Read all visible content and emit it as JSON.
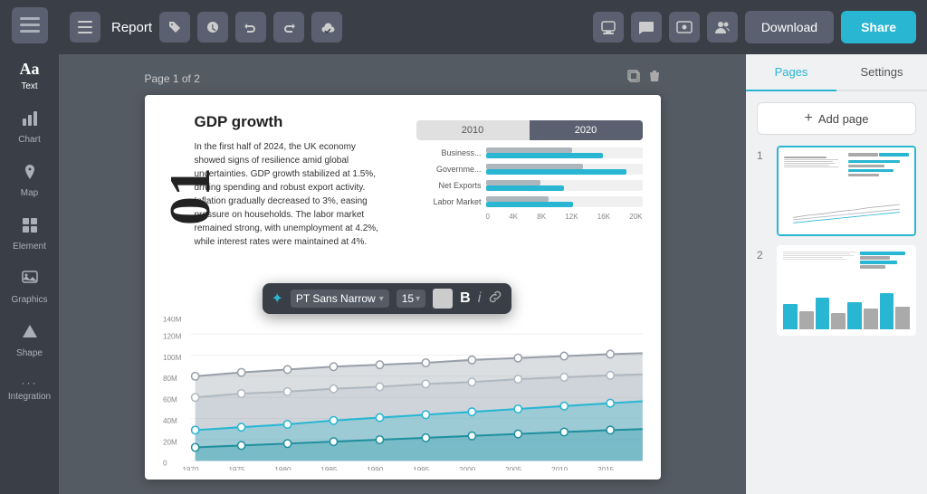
{
  "app": {
    "title": "Report",
    "download_label": "Download",
    "share_label": "Share"
  },
  "sidebar": {
    "items": [
      {
        "id": "text",
        "label": "Text",
        "icon": "Aa"
      },
      {
        "id": "chart",
        "label": "Chart",
        "icon": "📊"
      },
      {
        "id": "map",
        "label": "Map",
        "icon": "🗺"
      },
      {
        "id": "element",
        "label": "Element",
        "icon": "⊞"
      },
      {
        "id": "graphics",
        "label": "Graphics",
        "icon": "🖼"
      },
      {
        "id": "shape",
        "label": "Shape",
        "icon": "⬟"
      },
      {
        "id": "integration",
        "label": "Integration",
        "icon": "···"
      }
    ]
  },
  "page_info": {
    "current": "Page 1 of 2"
  },
  "right_panel": {
    "tabs": [
      "Pages",
      "Settings"
    ],
    "active_tab": "Pages",
    "add_page_label": "Add page"
  },
  "format_toolbar": {
    "font": "PT Sans Narrow",
    "size": "15",
    "bold": "B",
    "italic": "i"
  },
  "chart_tabs": [
    "2010",
    "2020"
  ],
  "bar_chart": {
    "rows": [
      {
        "label": "Business...",
        "val2010": 55,
        "val2020": 75
      },
      {
        "label": "Governme...",
        "val2010": 60,
        "val2020": 90
      },
      {
        "label": "Net Exports",
        "val2010": 35,
        "val2020": 50
      },
      {
        "label": "Labor Market",
        "val2010": 40,
        "val2020": 55
      }
    ],
    "axis": [
      "0",
      "4K",
      "8K",
      "12K",
      "16K",
      "20K"
    ]
  },
  "gdp": {
    "title": "GDP growth",
    "body": "In the first half of 2024, the UK economy showed signs of resilience amid global uncertainties. GDP growth stabilized at 1.5%, driving spending and robust export activity. Inflation gradually decreased to 3%, easing pressure on households. The labor market remained strong, with unemployment at 4.2%, while interest rates were maintained at 4%.",
    "big_number": "01"
  },
  "line_chart": {
    "years": [
      "1970",
      "1975",
      "1980",
      "1985",
      "1990",
      "1995",
      "2000",
      "2005",
      "2010",
      "2015"
    ],
    "y_labels": [
      "0",
      "20M",
      "40M",
      "60M",
      "80M",
      "100M",
      "120M",
      "140M"
    ]
  }
}
